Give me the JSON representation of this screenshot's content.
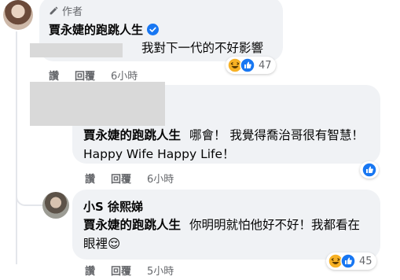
{
  "comment1": {
    "author_tag": "作者",
    "author": "賈永婕的跑跳人生",
    "text": "我對下一代的不好影響",
    "reaction_count": "47",
    "actions": {
      "like": "讚",
      "reply": "回覆",
      "time": "6小時"
    }
  },
  "comment2": {
    "author": "賈永婕的跑跳人生",
    "text": "哪會！ 我覺得喬治哥很有智慧！ Happy Wife Happy Life！",
    "actions": {
      "like": "讚",
      "reply": "回覆",
      "time": "6小時"
    }
  },
  "comment3": {
    "author": "小S 徐熙娣",
    "mention": "賈永婕的跑跳人生",
    "text": "你明明就怕他好不好！我都看在眼裡😌",
    "reaction_count": "45",
    "actions": {
      "like": "讚",
      "reply": "回覆",
      "time": "5小時"
    }
  },
  "colors": {
    "bubble": "#f0f2f5",
    "verified": "#1877f2",
    "like": "#1877f2",
    "haha": "#f7b125",
    "muted": "#65676b"
  },
  "icons": [
    "pencil-icon",
    "verified-badge-icon",
    "haha-reaction-icon",
    "like-reaction-icon"
  ]
}
